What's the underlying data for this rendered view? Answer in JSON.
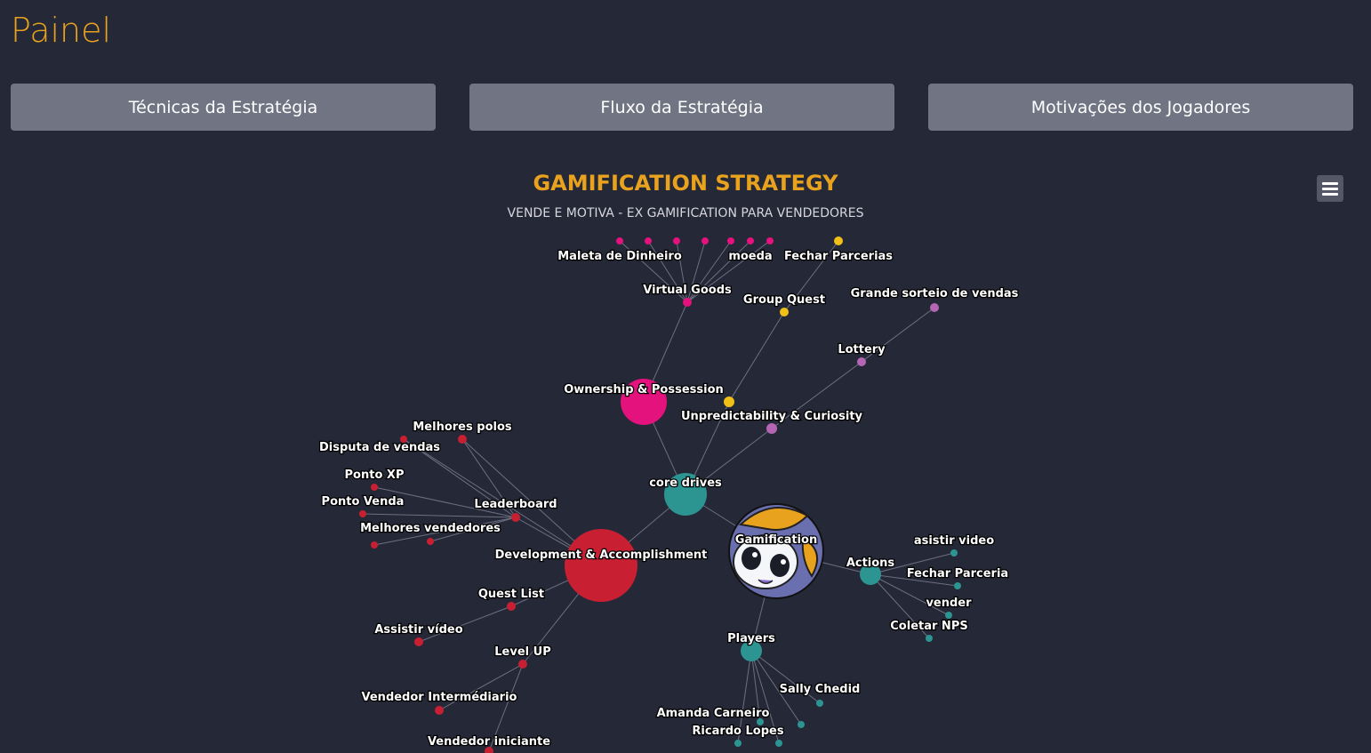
{
  "header": {
    "title": "Painel"
  },
  "tabs": [
    {
      "label": "Técnicas da Estratégia"
    },
    {
      "label": "Fluxo da Estratégia"
    },
    {
      "label": "Motivações dos Jogadores"
    }
  ],
  "chart_data": {
    "type": "network",
    "title": "GAMIFICATION STRATEGY",
    "subtitle": "VENDE E MOTIVA - EX GAMIFICATION PARA VENDEDORES",
    "colors": {
      "teal": "#2c9592",
      "red": "#c81f32",
      "pink": "#e3127d",
      "yellow": "#f0c018",
      "purple": "#b466b5",
      "root_bg": "#6a6fb0",
      "root_accent": "#e8a21e"
    },
    "nodes": [
      {
        "id": "gamification",
        "label": "Gamification",
        "group": "root"
      },
      {
        "id": "core_drives",
        "label": "core drives",
        "group": "teal"
      },
      {
        "id": "actions",
        "label": "Actions",
        "group": "teal"
      },
      {
        "id": "players",
        "label": "Players",
        "group": "teal"
      },
      {
        "id": "dev",
        "label": "Development & Accomplishment",
        "group": "red"
      },
      {
        "id": "owner",
        "label": "Ownership & Possession",
        "group": "pink"
      },
      {
        "id": "unpred",
        "label": "Unpredictability & Curiosity",
        "group": "purple"
      },
      {
        "id": "social",
        "label": "",
        "group": "yellow"
      },
      {
        "id": "virtual_goods",
        "label": "Virtual Goods",
        "group": "pink"
      },
      {
        "id": "maleta",
        "label": "Maleta de Dinheiro",
        "group": "pink"
      },
      {
        "id": "moeda",
        "label": "moeda",
        "group": "pink"
      },
      {
        "id": "pk1",
        "label": "",
        "group": "pink"
      },
      {
        "id": "pk2",
        "label": "",
        "group": "pink"
      },
      {
        "id": "pk3",
        "label": "",
        "group": "pink"
      },
      {
        "id": "pk4",
        "label": "",
        "group": "pink"
      },
      {
        "id": "pk5",
        "label": "",
        "group": "pink"
      },
      {
        "id": "group_quest",
        "label": "Group Quest",
        "group": "yellow"
      },
      {
        "id": "fechar_parcerias",
        "label": "Fechar Parcerias",
        "group": "yellow"
      },
      {
        "id": "lottery",
        "label": "Lottery",
        "group": "purple"
      },
      {
        "id": "sorteio",
        "label": "Grande sorteio de vendas",
        "group": "purple"
      },
      {
        "id": "leaderboard",
        "label": "Leaderboard",
        "group": "red"
      },
      {
        "id": "melhores_polos",
        "label": "Melhores polos",
        "group": "red"
      },
      {
        "id": "disputa",
        "label": "Disputa de vendas",
        "group": "red"
      },
      {
        "id": "ponto_xp",
        "label": "Ponto XP",
        "group": "red"
      },
      {
        "id": "ponto_venda",
        "label": "Ponto Venda",
        "group": "red"
      },
      {
        "id": "melhores_vend",
        "label": "Melhores vendedores",
        "group": "red"
      },
      {
        "id": "r1",
        "label": "",
        "group": "red"
      },
      {
        "id": "quest_list",
        "label": "Quest List",
        "group": "red"
      },
      {
        "id": "assistir_video_r",
        "label": "Assistir vídeo",
        "group": "red"
      },
      {
        "id": "level_up",
        "label": "Level UP",
        "group": "red"
      },
      {
        "id": "vend_inter",
        "label": "Vendedor Intermédiario",
        "group": "red"
      },
      {
        "id": "vend_inic",
        "label": "Vendedor iniciante",
        "group": "red"
      },
      {
        "id": "asistir_video",
        "label": "asistir video",
        "group": "teal"
      },
      {
        "id": "fechar_parceria",
        "label": "Fechar Parceria",
        "group": "teal"
      },
      {
        "id": "vender",
        "label": "vender",
        "group": "teal"
      },
      {
        "id": "coletar_nps",
        "label": "Coletar NPS",
        "group": "teal"
      },
      {
        "id": "sally",
        "label": "Sally Chedid",
        "group": "teal"
      },
      {
        "id": "amanda",
        "label": "Amanda Carneiro",
        "group": "teal"
      },
      {
        "id": "ricardo",
        "label": "Ricardo Lopes",
        "group": "teal"
      },
      {
        "id": "t1",
        "label": "",
        "group": "teal"
      },
      {
        "id": "t2",
        "label": "",
        "group": "teal"
      }
    ]
  }
}
